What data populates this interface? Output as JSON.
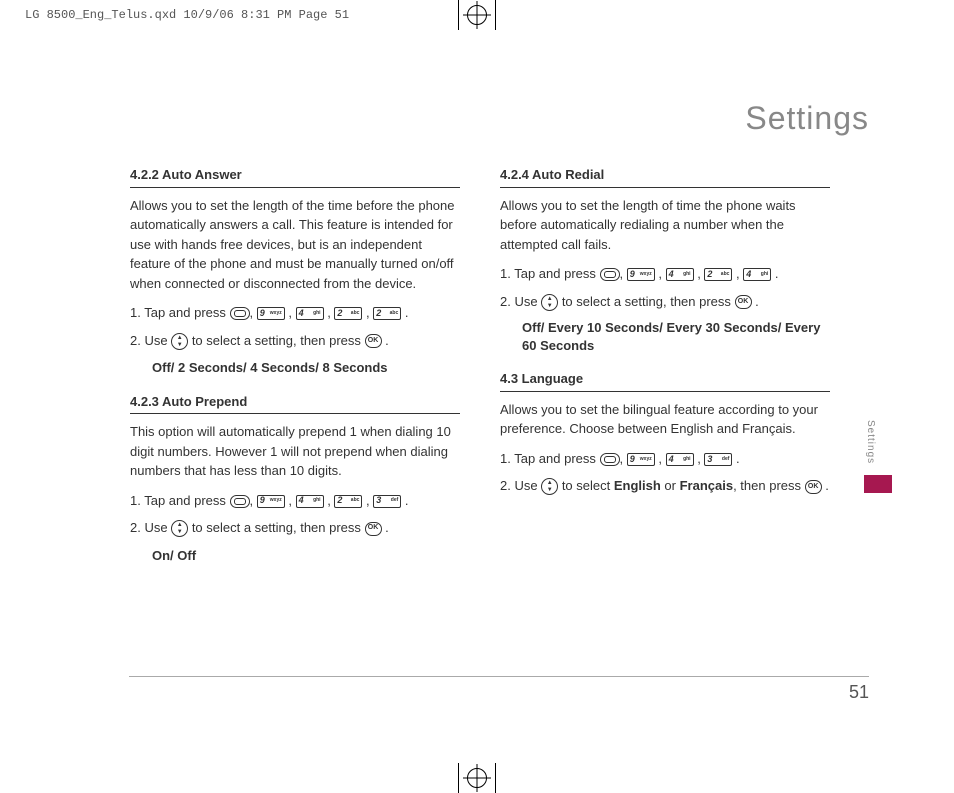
{
  "header": "LG 8500_Eng_Telus.qxd  10/9/06  8:31 PM  Page 51",
  "pageTitle": "Settings",
  "sideTab": "Settings",
  "pageNumber": "51",
  "sections": {
    "s1": {
      "heading": "4.2.2 Auto Answer",
      "para": "Allows you to set the length of the time before the phone automatically answers a call. This feature is intended for use with hands free devices, but is an independent feature of the phone and must be manually turned on/off when connected or disconnected from the device.",
      "step1a": "1.  Tap and press ",
      "step2a": "2.  Use ",
      "step2b": " to select a setting, then press ",
      "options": "Off/ 2 Seconds/ 4 Seconds/ 8 Seconds"
    },
    "s2": {
      "heading": "4.2.3 Auto Prepend",
      "para": "This option will automatically prepend 1 when dialing 10 digit numbers. However 1 will not prepend when dialing numbers that has less than 10 digits.",
      "step1a": "1.  Tap and press ",
      "step2a": "2.  Use ",
      "step2b": " to select a setting, then press ",
      "options": "On/ Off"
    },
    "s3": {
      "heading": "4.2.4 Auto Redial",
      "para": "Allows you to set the length of time the phone waits before automatically redialing a number when the attempted call fails.",
      "step1a": "1.  Tap and press ",
      "step2a": "2.  Use ",
      "step2b": " to select a setting, then press ",
      "options": "Off/ Every 10 Seconds/ Every 30 Seconds/ Every 60 Seconds"
    },
    "s4": {
      "heading": "4.3 Language",
      "para": "Allows you to set the bilingual feature according to your preference. Choose between English and Français.",
      "step1a": "1.  Tap and press ",
      "step2a": "2.  Use ",
      "step2b": " to select ",
      "step2c": "English",
      "step2d": " or ",
      "step2e": "Français",
      "step2f": ", then press "
    }
  },
  "keys": {
    "k9": {
      "num": "9",
      "letters": "wxyz"
    },
    "k4": {
      "num": "4",
      "letters": "ghi"
    },
    "k2": {
      "num": "2",
      "letters": "abc"
    },
    "k3": {
      "num": "3",
      "letters": "def"
    }
  }
}
